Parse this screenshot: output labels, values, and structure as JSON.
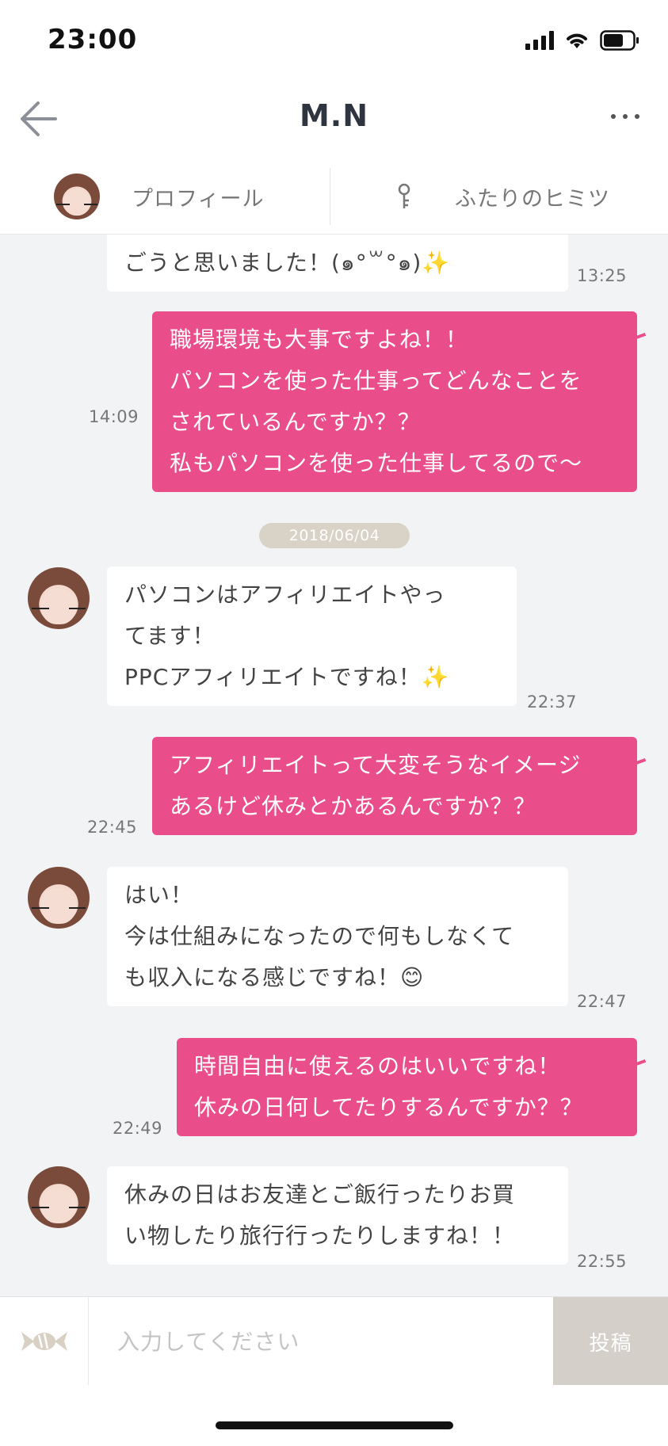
{
  "status_bar": {
    "time": "23:00"
  },
  "header": {
    "title": "M.N"
  },
  "subnav": {
    "profile_label": "プロフィール",
    "secret_label": "ふたりのヒミツ"
  },
  "messages": [
    {
      "side": "in",
      "lines": [
        "ごうと思いました！(๑°꒳°๑)✨"
      ],
      "time": "13:25",
      "avatar": false
    },
    {
      "side": "out",
      "lines": [
        "職場環境も大事ですよね！！",
        "パソコンを使った仕事ってどんなことを",
        "されているんですか？？",
        "私もパソコンを使った仕事してるので〜"
      ],
      "time": "14:09"
    },
    {
      "side": "in",
      "lines": [
        "パソコンはアフィリエイトやっ",
        "てます！",
        "PPCアフィリエイトですね！✨"
      ],
      "time": "22:37",
      "avatar": true
    },
    {
      "side": "out",
      "lines": [
        "アフィリエイトって大変そうなイメージ",
        "あるけど休みとかあるんですか？？"
      ],
      "time": "22:45"
    },
    {
      "side": "in",
      "lines": [
        "はい！",
        "今は仕組みになったので何もしなくて",
        "も収入になる感じですね！😊"
      ],
      "time": "22:47",
      "avatar": true
    },
    {
      "side": "out",
      "lines": [
        "時間自由に使えるのはいいですね！",
        "休みの日何してたりするんですか？？"
      ],
      "time": "22:49"
    },
    {
      "side": "in",
      "lines": [
        "休みの日はお友達とご飯行ったりお買",
        "い物したり旅行行ったりしますね！！"
      ],
      "time": "22:55",
      "avatar": true
    }
  ],
  "date_divider": "2018/06/04",
  "composer": {
    "placeholder": "入力してください",
    "send_label": "投稿"
  },
  "colors": {
    "accent_pink": "#e94d8a",
    "send_disabled": "#d4cfc8",
    "chat_bg": "#f2f3f5"
  },
  "icons": {
    "back": "arrow-left-icon",
    "more": "more-dots-icon",
    "key": "key-icon",
    "candy": "candy-icon"
  }
}
